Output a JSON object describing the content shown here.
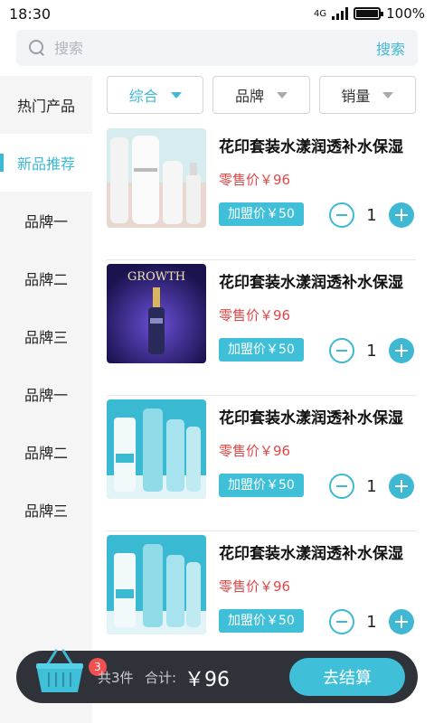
{
  "status": {
    "time": "18:30",
    "network": "4G",
    "battery": "100%"
  },
  "search": {
    "placeholder": "搜索",
    "button": "搜索"
  },
  "sidebar": {
    "items": [
      {
        "label": "热门产品"
      },
      {
        "label": "新品推荐",
        "active": true
      },
      {
        "label": "品牌一"
      },
      {
        "label": "品牌二"
      },
      {
        "label": "品牌三"
      },
      {
        "label": "品牌一"
      },
      {
        "label": "品牌二"
      },
      {
        "label": "品牌三"
      }
    ]
  },
  "filters": [
    {
      "label": "综合",
      "active": true
    },
    {
      "label": "品牌"
    },
    {
      "label": "销量"
    }
  ],
  "products": [
    {
      "name": "花印套装水漾润透补水保湿",
      "retail": "零售价￥96",
      "join": "加盟价￥50",
      "qty": "1",
      "image": "brand-cream-bottles-image"
    },
    {
      "name": "花印套装水漾润透补水保湿",
      "retail": "零售价￥96",
      "join": "加盟价￥50",
      "qty": "1",
      "image": "growth-serum-image",
      "image_text": "GROWTH"
    },
    {
      "name": "花印套装水漾润透补水保湿",
      "retail": "零售价￥96",
      "join": "加盟价￥50",
      "qty": "1",
      "image": "aqua-skincare-set-image"
    },
    {
      "name": "花印套装水漾润透补水保湿",
      "retail": "零售价￥96",
      "join": "加盟价￥50",
      "qty": "1",
      "image": "aqua-skincare-set-image"
    }
  ],
  "cart": {
    "badge": "3",
    "count": "共3件",
    "total_label": "合计:",
    "total": "￥96",
    "checkout": "去结算"
  },
  "colors": {
    "accent": "#3fb8d4",
    "price": "#e04848",
    "cartbar": "#2f3339"
  }
}
